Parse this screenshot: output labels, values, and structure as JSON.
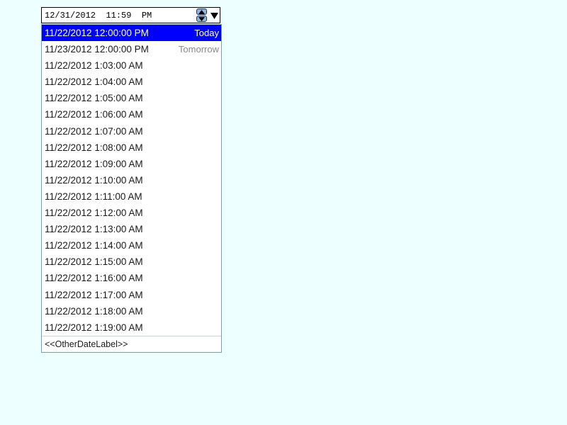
{
  "picker": {
    "value": "12/31/2012  11:59  PM",
    "spin_up_icon": "triangle-up-icon",
    "spin_down_icon": "triangle-down-icon",
    "dropdown_icon": "triangle-down-icon"
  },
  "list": {
    "selected_index": 0,
    "items": [
      {
        "text": "11/22/2012 12:00:00 PM",
        "label": "Today"
      },
      {
        "text": "11/23/2012 12:00:00 PM",
        "label": "Tomorrow"
      },
      {
        "text": "11/22/2012 1:03:00 AM",
        "label": ""
      },
      {
        "text": "11/22/2012 1:04:00 AM",
        "label": ""
      },
      {
        "text": "11/22/2012 1:05:00 AM",
        "label": ""
      },
      {
        "text": "11/22/2012 1:06:00 AM",
        "label": ""
      },
      {
        "text": "11/22/2012 1:07:00 AM",
        "label": ""
      },
      {
        "text": "11/22/2012 1:08:00 AM",
        "label": ""
      },
      {
        "text": "11/22/2012 1:09:00 AM",
        "label": ""
      },
      {
        "text": "11/22/2012 1:10:00 AM",
        "label": ""
      },
      {
        "text": "11/22/2012 1:11:00 AM",
        "label": ""
      },
      {
        "text": "11/22/2012 1:12:00 AM",
        "label": ""
      },
      {
        "text": "11/22/2012 1:13:00 AM",
        "label": ""
      },
      {
        "text": "11/22/2012 1:14:00 AM",
        "label": ""
      },
      {
        "text": "11/22/2012 1:15:00 AM",
        "label": ""
      },
      {
        "text": "11/22/2012 1:16:00 AM",
        "label": ""
      },
      {
        "text": "11/22/2012 1:17:00 AM",
        "label": ""
      },
      {
        "text": "11/22/2012 1:18:00 AM",
        "label": ""
      },
      {
        "text": "11/22/2012 1:19:00 AM",
        "label": ""
      }
    ],
    "footer_label": "<<OtherDateLabel>>"
  },
  "colors": {
    "background": "#eeffff",
    "selection": "#0000ff",
    "secondary_label": "#888888"
  }
}
